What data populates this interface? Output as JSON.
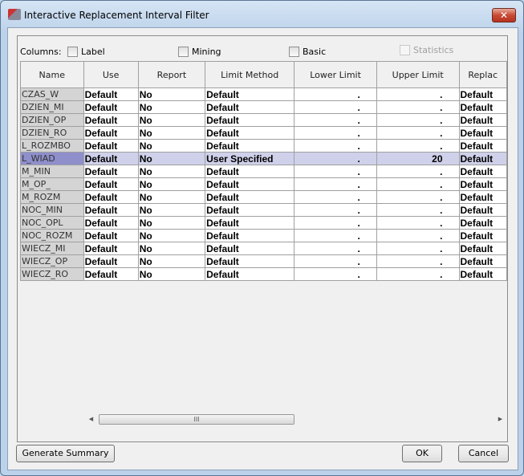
{
  "window": {
    "title": "Interactive Replacement Interval Filter",
    "close_icon": "close-icon"
  },
  "columns_label": "Columns:",
  "checkboxes": [
    {
      "label": "Label",
      "checked": false,
      "enabled": true
    },
    {
      "label": "Mining",
      "checked": false,
      "enabled": true
    },
    {
      "label": "Basic",
      "checked": false,
      "enabled": true
    },
    {
      "label": "Statistics",
      "checked": false,
      "enabled": false
    }
  ],
  "table": {
    "headers": [
      "Name",
      "Use",
      "Report",
      "Limit Method",
      "Lower Limit",
      "Upper Limit",
      "Replac"
    ],
    "rows": [
      [
        "CZAS_W",
        "Default",
        "No",
        "Default",
        ".",
        ".",
        "Default"
      ],
      [
        "DZIEN_MI",
        "Default",
        "No",
        "Default",
        ".",
        ".",
        "Default"
      ],
      [
        "DZIEN_OP",
        "Default",
        "No",
        "Default",
        ".",
        ".",
        "Default"
      ],
      [
        "DZIEN_RO",
        "Default",
        "No",
        "Default",
        ".",
        ".",
        "Default"
      ],
      [
        "L_ROZMBO",
        "Default",
        "No",
        "Default",
        ".",
        ".",
        "Default"
      ],
      [
        "L_WIAD",
        "Default",
        "No",
        "User Specified",
        ".",
        "20",
        "Default"
      ],
      [
        "M_MIN",
        "Default",
        "No",
        "Default",
        ".",
        ".",
        "Default"
      ],
      [
        "M_OP_",
        "Default",
        "No",
        "Default",
        ".",
        ".",
        "Default"
      ],
      [
        "M_ROZM",
        "Default",
        "No",
        "Default",
        ".",
        ".",
        "Default"
      ],
      [
        "NOC_MIN",
        "Default",
        "No",
        "Default",
        ".",
        ".",
        "Default"
      ],
      [
        "NOC_OPL",
        "Default",
        "No",
        "Default",
        ".",
        ".",
        "Default"
      ],
      [
        "NOC_ROZM",
        "Default",
        "No",
        "Default",
        ".",
        ".",
        "Default"
      ],
      [
        "WIECZ_MI",
        "Default",
        "No",
        "Default",
        ".",
        ".",
        "Default"
      ],
      [
        "WIECZ_OP",
        "Default",
        "No",
        "Default",
        ".",
        ".",
        "Default"
      ],
      [
        "WIECZ_RO",
        "Default",
        "No",
        "Default",
        ".",
        ".",
        "Default"
      ]
    ],
    "selected_row": 5
  },
  "scrollbar": {
    "thumb_grip": "III"
  },
  "buttons": {
    "generate": "Generate Summary",
    "ok": "OK",
    "cancel": "Cancel"
  },
  "colors": {
    "selected_row": "#cfd0ea",
    "selected_name": "#8f8fcc",
    "close": "#c74a35"
  }
}
